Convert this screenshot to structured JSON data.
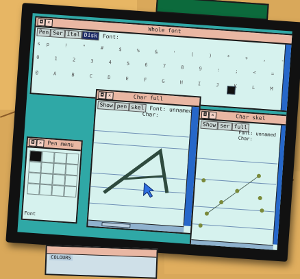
{
  "whole_font": {
    "title": "Whole font",
    "tabs": [
      "Pen",
      "Ser",
      "Ital",
      "Disk"
    ],
    "font_label": "Font:",
    "char_rows": [
      "sp ! \" # $ % & ' ( ) * + , - . /",
      "0 1 2 3 4 5 6 7 8 9 : ; < = > ?",
      "@ A B C D E F G H I J K L M N O P"
    ]
  },
  "char_full_left": {
    "title": "Char full",
    "buttons": [
      "Show",
      "pen",
      "skel"
    ],
    "font_line": "Font: unnamed",
    "char_line": "Char:"
  },
  "char_full_right": {
    "title": "Char skel",
    "buttons": [
      "Show",
      "ser",
      "full"
    ],
    "font_line": "Font: unnamed",
    "char_line": "Char:"
  },
  "pen_menu": {
    "title": "Pen menu",
    "footer": "Font"
  },
  "colours_window": {
    "title": "COLOURS"
  },
  "colors": {
    "desktop": "#2fa8a6",
    "window_bg": "#d6f2ee",
    "titlebar": "#e9b7a3",
    "scrollbar": "#2667c9",
    "glyph_stroke": "#2e4a3e",
    "pen_cursor": "#2f6fe0"
  }
}
